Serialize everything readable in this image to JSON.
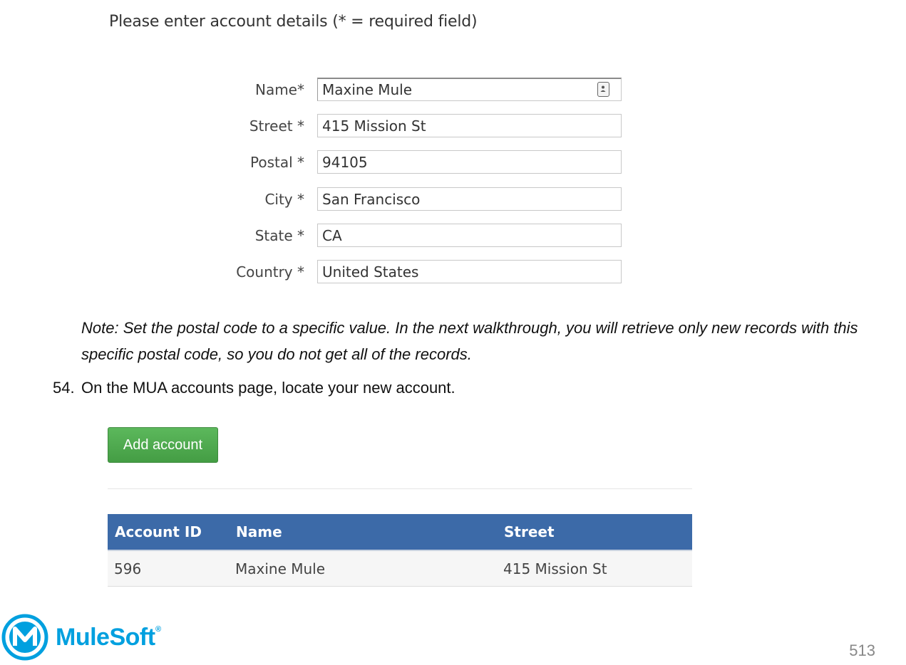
{
  "intro": "Please enter account details (* = required field)",
  "form": {
    "fields": [
      {
        "label": "Name*",
        "value": "Maxine Mule"
      },
      {
        "label": "Street *",
        "value": "415 Mission St"
      },
      {
        "label": "Postal *",
        "value": "94105"
      },
      {
        "label": "City *",
        "value": "San Francisco"
      },
      {
        "label": "State *",
        "value": "CA"
      },
      {
        "label": "Country *",
        "value": "United States"
      }
    ]
  },
  "note": "Note: Set the postal code to a specific value. In the next walkthrough, you will retrieve only new records with this specific postal code, so you do not get all of the records.",
  "step": {
    "number": "54.",
    "text": "On the MUA accounts page, locate your new account."
  },
  "accounts": {
    "add_button": "Add account",
    "columns": [
      "Account ID",
      "Name",
      "Street"
    ],
    "rows": [
      [
        "596",
        "Maxine Mule",
        "415 Mission St"
      ]
    ]
  },
  "brand": {
    "name": "MuleSoft",
    "mark": "®",
    "color": "#00a0df"
  },
  "page_number": "513"
}
